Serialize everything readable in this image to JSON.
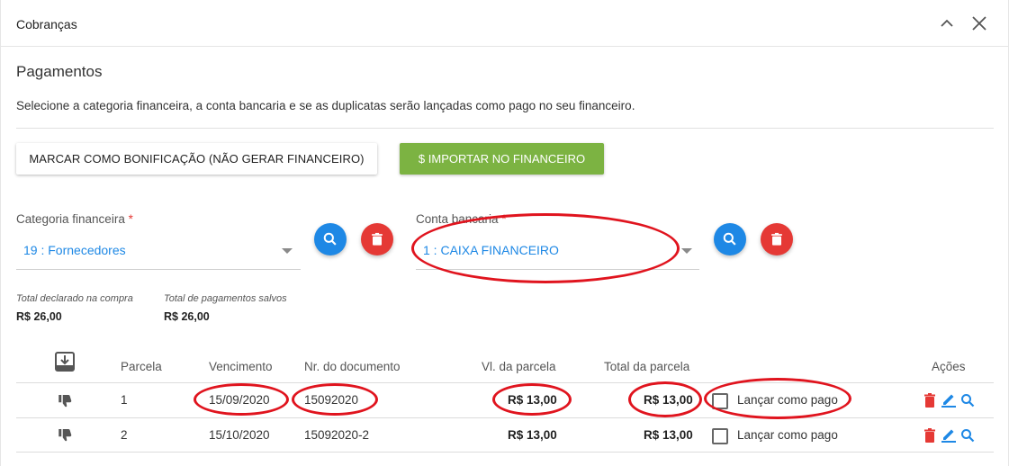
{
  "window": {
    "title": "Cobranças",
    "collapse_icon": "chevron-up-icon",
    "close_icon": "close-icon"
  },
  "section": {
    "title": "Pagamentos",
    "description": "Selecione a categoria financeira, a conta bancaria e se as duplicatas serão lançadas como pago no seu financeiro."
  },
  "buttons": {
    "bonificacao_label": "MARCAR COMO BONIFICAÇÃO (NÃO GERAR FINANCEIRO)",
    "importar_label": "$ IMPORTAR NO FINANCEIRO"
  },
  "fields": {
    "categoria": {
      "label": "Categoria financeira",
      "required_mark": "*",
      "value": "19 : Fornecedores"
    },
    "conta": {
      "label": "Conta bancaria",
      "required_mark": "*",
      "value": "1 : CAIXA FINANCEIRO"
    }
  },
  "totals": {
    "declarado_label": "Total declarado na compra",
    "declarado_value": "R$ 26,00",
    "salvos_label": "Total de pagamentos salvos",
    "salvos_value": "R$ 26,00"
  },
  "table": {
    "columns": {
      "parcela": "Parcela",
      "vencimento": "Vencimento",
      "documento": "Nr. do documento",
      "vl_parcela": "Vl. da parcela",
      "total_parcela": "Total da parcela",
      "acoes": "Ações"
    },
    "rows": [
      {
        "parcela": "1",
        "vencimento": "15/09/2020",
        "documento": "15092020",
        "vl_parcela": "R$ 13,00",
        "total_parcela": "R$ 13,00",
        "lancar_label": "Lançar como pago",
        "lancar_checked": false
      },
      {
        "parcela": "2",
        "vencimento": "15/10/2020",
        "documento": "15092020-2",
        "vl_parcela": "R$ 13,00",
        "total_parcela": "R$ 13,00",
        "lancar_label": "Lançar como pago",
        "lancar_checked": false
      }
    ]
  },
  "colors": {
    "accent_blue": "#1e88e5",
    "danger_red": "#e53935",
    "success_green": "#7cb342",
    "annotation_red": "#e0141e"
  }
}
